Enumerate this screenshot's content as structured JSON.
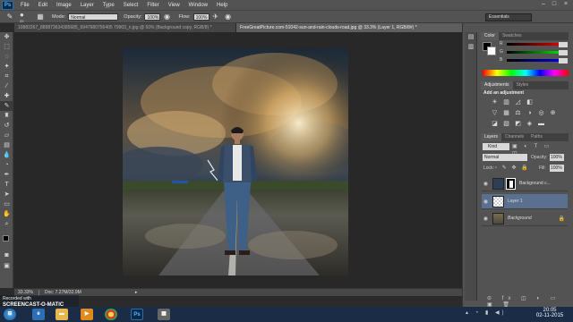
{
  "app": {
    "logo": "Ps",
    "menu": [
      "File",
      "Edit",
      "Image",
      "Layer",
      "Type",
      "Select",
      "Filter",
      "View",
      "Window",
      "Help"
    ]
  },
  "options_bar": {
    "brush_size": "22",
    "mode_label": "Mode:",
    "mode_value": "Normal",
    "opacity_label": "Opacity:",
    "opacity_value": "100%",
    "flow_label": "Flow:",
    "flow_value": "100%",
    "workspace": "Essentials"
  },
  "tabs": [
    {
      "label": "10882267_889873634385685_6947680756405 79903_n.jpg @ 50% (Background copy, RGB/8) *",
      "active": false
    },
    {
      "label": "FreeGreatPicture.com-51042-sun-and-rain-clouds-road.jpg @ 33.3% (Layer 1, RGB/8#) *",
      "active": true
    }
  ],
  "status_bar": {
    "zoom": "33.33%",
    "doc": "Doc: 7.27M/32.9M"
  },
  "color_panel": {
    "tabs": [
      "Color",
      "Swatches"
    ],
    "channels": [
      "R",
      "G",
      "B"
    ],
    "values": [
      "0",
      "0",
      "0"
    ]
  },
  "adjustments_panel": {
    "tabs": [
      "Adjustments",
      "Styles"
    ],
    "heading": "Add an adjustment"
  },
  "layers_panel": {
    "tabs": [
      "Layers",
      "Channels",
      "Paths"
    ],
    "kind_label": "Kind",
    "blend_mode": "Normal",
    "opacity_label": "Opacity:",
    "opacity_value": "100%",
    "lock_label": "Lock:",
    "fill_label": "Fill:",
    "fill_value": "100%",
    "layers": [
      {
        "name": "Background c...",
        "selected": false
      },
      {
        "name": "Layer 1",
        "selected": true
      },
      {
        "name": "Background",
        "selected": false
      }
    ]
  },
  "watermark": {
    "line1": "Recorded with",
    "line2": "SCREENCAST-O-MATIC"
  },
  "taskbar": {
    "time": "20:05",
    "date": "02-11-2015"
  },
  "colors": {
    "chrome": "#535353",
    "canvas_bg": "#282828",
    "selection": "#5b6f8f",
    "taskbar": "#1a2c46"
  }
}
